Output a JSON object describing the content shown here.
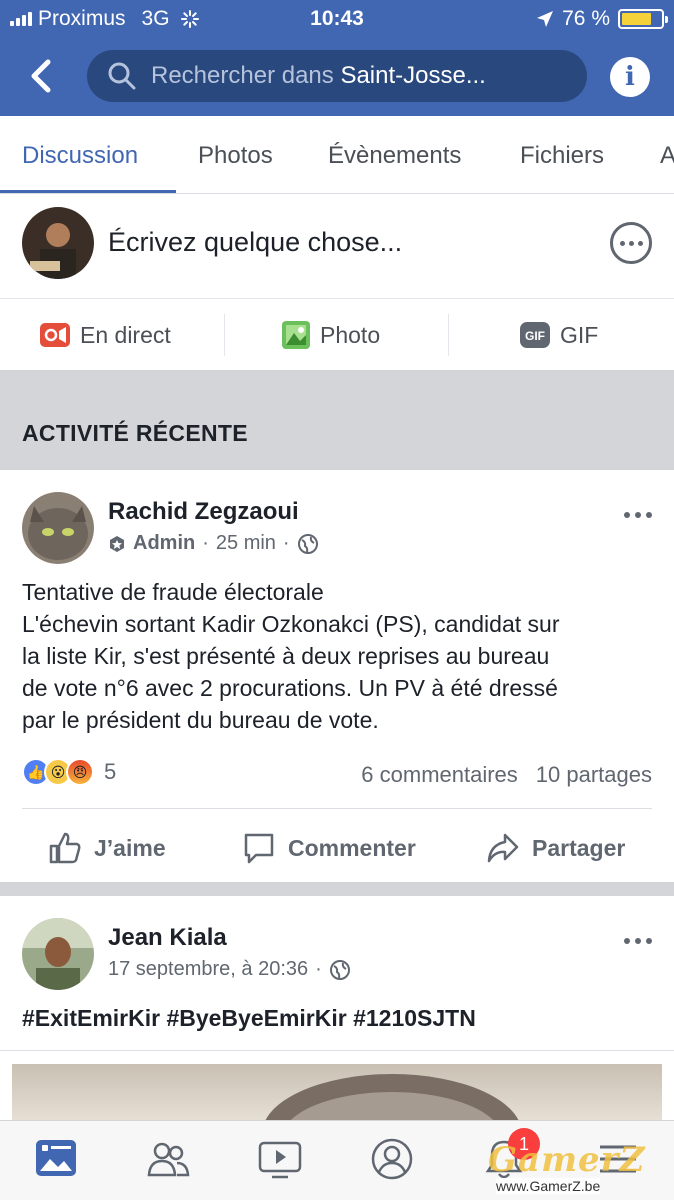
{
  "status_bar": {
    "carrier": "Proximus",
    "network": "3G",
    "time": "10:43",
    "battery": "76 %",
    "battery_level": 0.76
  },
  "header": {
    "search_placeholder": "Rechercher dans",
    "search_group": "Saint-Josse..."
  },
  "tabs": [
    {
      "label": "Discussion"
    },
    {
      "label": "Photos"
    },
    {
      "label": "Évènements"
    },
    {
      "label": "Fichiers"
    },
    {
      "label": "A"
    }
  ],
  "composer": {
    "prompt": "Écrivez quelque chose..."
  },
  "composer_actions": [
    {
      "label": "En direct",
      "icon": "live-video-icon"
    },
    {
      "label": "Photo",
      "icon": "photo-icon"
    },
    {
      "label": "GIF",
      "icon": "gif-icon"
    }
  ],
  "section": {
    "title": "ACTIVITÉ RÉCENTE"
  },
  "posts": [
    {
      "author": "Rachid Zegzaoui",
      "role": "Admin",
      "time": "25 min",
      "lines": [
        "Tentative de fraude électorale",
        "L'échevin sortant Kadir Ozkonakci (PS), candidat sur",
        "la liste Kir, s'est présenté à deux reprises au bureau",
        "de vote n°6 avec 2 procurations. Un PV à été dressé",
        "par le président du bureau de vote."
      ],
      "reaction_count": "5",
      "comments": "6 commentaires",
      "shares": "10 partages",
      "buttons": {
        "like": "J’aime",
        "comment": "Commenter",
        "share": "Partager"
      }
    },
    {
      "author": "Jean Kiala",
      "time": "17 septembre, à 20:36",
      "text": "#ExitEmirKir #ByeByeEmirKir #1210SJTN"
    }
  ],
  "bottom_nav": {
    "notification_badge": "1"
  },
  "watermark": {
    "logo": "GamerZ",
    "url": "www.GamerZ.be"
  }
}
